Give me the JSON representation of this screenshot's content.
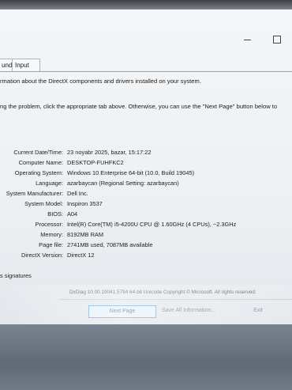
{
  "window": {
    "maximize_glyph": "",
    "minimize_glyph": ""
  },
  "tabs": [
    {
      "label": "und"
    },
    {
      "label": "Input"
    }
  ],
  "intro": {
    "line1": "rmation about the DirectX components and drivers installed on your system.",
    "line2": "ng the problem, click the appropriate tab above.  Otherwise, you can use the \"Next Page\" button below to"
  },
  "system_info": {
    "rows": [
      {
        "label": "Current Date/Time:",
        "value": "23 noyabr 2025, bazar, 15:17:22"
      },
      {
        "label": "Computer Name:",
        "value": "DESKTOP-FUHFKC2"
      },
      {
        "label": "Operating System:",
        "value": "Windows 10 Enterprise 64-bit (10.0, Build 19045)"
      },
      {
        "label": "Language:",
        "value": "azarbaycan (Regional Setting: azarbaycan)"
      },
      {
        "label": "System Manufacturer:",
        "value": "Dell Inc."
      },
      {
        "label": "System Model:",
        "value": "Inspiron 3537"
      },
      {
        "label": "BIOS:",
        "value": "A04"
      },
      {
        "label": "Processor:",
        "value": "Intel(R) Core(TM) i5-4200U CPU @ 1.60GHz (4 CPUs), ~2.3GHz"
      },
      {
        "label": "Memory:",
        "value": "8192MB RAM"
      },
      {
        "label": "Page file:",
        "value": "2741MB used, 7087MB available"
      },
      {
        "label": "DirectX Version:",
        "value": "DirectX 12"
      }
    ]
  },
  "signatures_label": "s signatures",
  "footer": {
    "version_line": "DxDiag 10.00.19041.5794 64-bit Unicode  Copyright © Microsoft. All rights reserved.",
    "next_page": "Next Page",
    "save_all": "Save All Information...",
    "exit": "Exit"
  }
}
